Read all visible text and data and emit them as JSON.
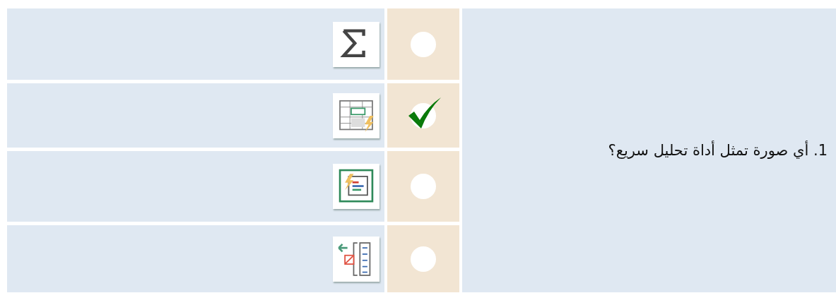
{
  "question": {
    "text": "1. أي صورة تمثل أداة تحليل سريع؟"
  },
  "options": [
    {
      "kind": "sum",
      "selected": false
    },
    {
      "kind": "quick-analysis",
      "selected": true
    },
    {
      "kind": "flash-form",
      "selected": false
    },
    {
      "kind": "remove-list",
      "selected": false
    }
  ]
}
